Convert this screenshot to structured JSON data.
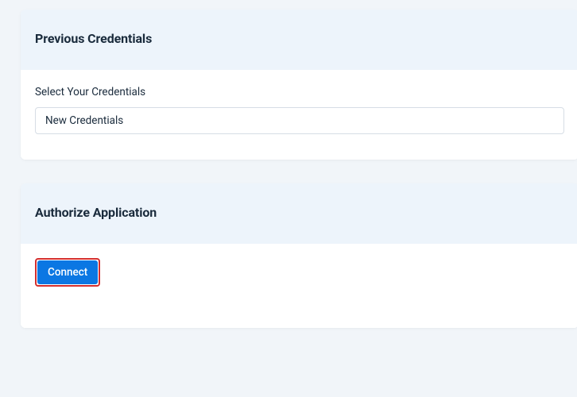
{
  "credentials_section": {
    "title": "Previous Credentials",
    "field_label": "Select Your Credentials",
    "selected_value": "New Credentials"
  },
  "authorize_section": {
    "title": "Authorize Application",
    "connect_button_label": "Connect"
  }
}
